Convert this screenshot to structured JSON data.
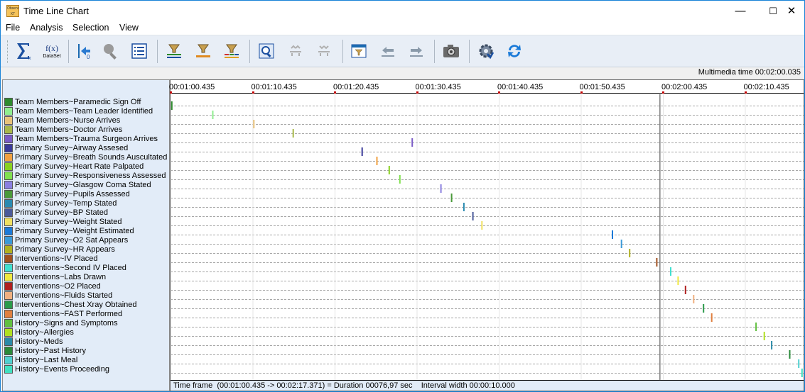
{
  "window": {
    "title": "Time Line Chart",
    "icon_text": "Observer XT",
    "controls": {
      "minimize": "—",
      "maximize": "☐",
      "close": "✕"
    }
  },
  "menu": [
    "File",
    "Analysis",
    "Selection",
    "View"
  ],
  "toolbar": {
    "buttons": [
      {
        "name": "sigma-icon"
      },
      {
        "name": "fx-dataset-icon",
        "text": "f(x)",
        "subtext": "DataSet"
      },
      {
        "name": "go-to-start-icon"
      },
      {
        "name": "search-disabled-icon"
      },
      {
        "name": "list-view-icon"
      },
      {
        "name": "filter-bars-icon"
      },
      {
        "name": "filter-single-icon"
      },
      {
        "name": "filter-multi-icon"
      },
      {
        "name": "zoom-icon"
      },
      {
        "name": "zoom-in-disabled-icon"
      },
      {
        "name": "zoom-out-disabled-icon"
      },
      {
        "name": "filter-window-icon"
      },
      {
        "name": "previous-event-icon"
      },
      {
        "name": "next-event-icon"
      },
      {
        "name": "camera-icon"
      },
      {
        "name": "settings-icon"
      },
      {
        "name": "refresh-icon"
      }
    ]
  },
  "multimedia_time": "Multimedia time 00:02:00.035",
  "axis": {
    "ticks": [
      "00:01:00.435",
      "00:01:10.435",
      "00:01:20.435",
      "00:01:30.435",
      "00:01:40.435",
      "00:01:50.435",
      "00:02:00.435",
      "00:02:10.435"
    ]
  },
  "footer": "Time frame  (00:01:00.435 -> 00:02:17.371) = Duration 00076,97 sec    Interval width 00:00:10.000",
  "chart_data": {
    "type": "timeline",
    "x_range_seconds": [
      60.435,
      137.371
    ],
    "cursor_seconds": 120.035,
    "series": [
      {
        "name": "Team Members~Paramedic Sign Off",
        "color": "#2e8b2e",
        "t": 60.5
      },
      {
        "name": "Team Members~Team Leader Identified",
        "color": "#90ee90",
        "t": 65.5
      },
      {
        "name": "Team Members~Nurse Arrives",
        "color": "#e8c27a",
        "t": 70.5
      },
      {
        "name": "Team Members~Doctor Arrives",
        "color": "#a8b84a",
        "t": 75.3
      },
      {
        "name": "Team Members~Trauma Surgeon Arrives",
        "color": "#7b5cc7",
        "t": 89.8
      },
      {
        "name": "Primary Survey~Airway Assesed",
        "color": "#3a3a9a",
        "t": 83.7
      },
      {
        "name": "Primary Survey~Breath Sounds Auscultated",
        "color": "#f0a040",
        "t": 85.5
      },
      {
        "name": "Primary Survey~Heart Rate Palpated",
        "color": "#88d020",
        "t": 87.0
      },
      {
        "name": "Primary Survey~Responsiveness Assessed",
        "color": "#80e050",
        "t": 88.3
      },
      {
        "name": "Primary Survey~Glasgow Coma Stated",
        "color": "#8a7fe0",
        "t": 93.3
      },
      {
        "name": "Primary Survey~Pupils Assessed",
        "color": "#4a9a3a",
        "t": 94.6
      },
      {
        "name": "Primary Survey~Temp Stated",
        "color": "#2a8ab0",
        "t": 96.1
      },
      {
        "name": "Primary Survey~BP Stated",
        "color": "#4a5a9a",
        "t": 97.2
      },
      {
        "name": "Primary Survey~Weight Stated",
        "color": "#f0e060",
        "t": 98.3
      },
      {
        "name": "Primary Survey~Weight Estimated",
        "color": "#1a7ad8",
        "t": 114.2
      },
      {
        "name": "Primary Survey~O2 Sat Appears",
        "color": "#3a9ad8",
        "t": 115.3
      },
      {
        "name": "Primary Survey~HR Appears",
        "color": "#b0b020",
        "t": 116.3
      },
      {
        "name": "Interventions~IV Placed",
        "color": "#a05020",
        "t": 119.6
      },
      {
        "name": "Interventions~Second IV Placed",
        "color": "#40e0d0",
        "t": 121.3
      },
      {
        "name": "Interventions~Labs Drawn",
        "color": "#f0e840",
        "t": 122.2
      },
      {
        "name": "Interventions~O2 Placed",
        "color": "#b02020",
        "t": 123.1
      },
      {
        "name": "Interventions~Fluids Started",
        "color": "#f0b080",
        "t": 124.1
      },
      {
        "name": "Interventions~Chest Xray Obtained",
        "color": "#2a9a4a",
        "t": 125.3
      },
      {
        "name": "Interventions~FAST Performed",
        "color": "#e08040",
        "t": 126.3
      },
      {
        "name": "History~Signs and Symptoms",
        "color": "#60c040",
        "t": 131.7
      },
      {
        "name": "History~Allergies",
        "color": "#b0e020",
        "t": 132.7
      },
      {
        "name": "History~Meds",
        "color": "#2a8aa8",
        "t": 133.6
      },
      {
        "name": "History~Past History",
        "color": "#2a8a3a",
        "t": 135.8
      },
      {
        "name": "History~Last Meal",
        "color": "#50d0d0",
        "t": 136.9
      },
      {
        "name": "History~Events Proceeding",
        "color": "#40e0c0",
        "t": 137.3
      }
    ]
  }
}
